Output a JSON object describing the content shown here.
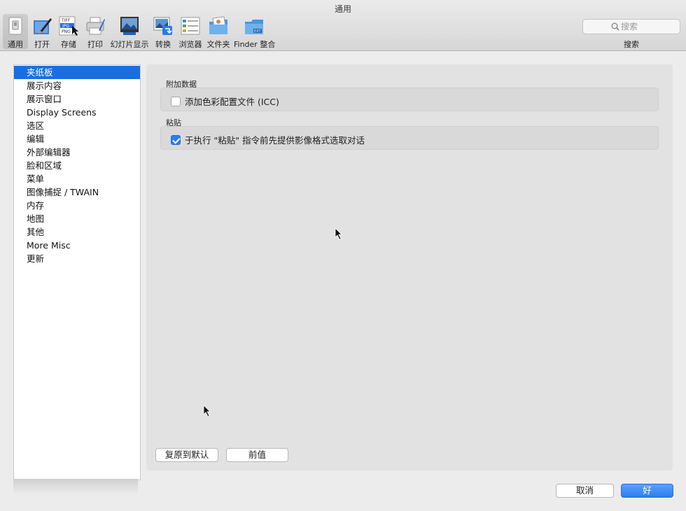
{
  "window": {
    "title": "通用"
  },
  "toolbar": {
    "items": [
      {
        "label": "通用",
        "icon": "general-switch-icon",
        "selected": true
      },
      {
        "label": "打开",
        "icon": "open-brush-icon",
        "selected": false
      },
      {
        "label": "存储",
        "icon": "save-formats-icon",
        "selected": false
      },
      {
        "label": "打印",
        "icon": "printer-icon",
        "selected": false
      },
      {
        "label": "幻灯片显示",
        "icon": "slideshow-icon",
        "selected": false
      },
      {
        "label": "转换",
        "icon": "convert-icon",
        "selected": false
      },
      {
        "label": "浏览器",
        "icon": "browser-icon",
        "selected": false
      },
      {
        "label": "文件夹",
        "icon": "folder-photo-icon",
        "selected": false
      },
      {
        "label": "Finder 整合",
        "icon": "finder-folder-icon",
        "selected": false
      }
    ],
    "search": {
      "placeholder": "搜索",
      "label": "搜索"
    }
  },
  "sidebar": {
    "items": [
      {
        "label": "夹纸板",
        "active": true
      },
      {
        "label": "展示内容",
        "active": false
      },
      {
        "label": "展示窗口",
        "active": false
      },
      {
        "label": "Display Screens",
        "active": false
      },
      {
        "label": "选区",
        "active": false
      },
      {
        "label": "编辑",
        "active": false
      },
      {
        "label": "外部编辑器",
        "active": false
      },
      {
        "label": "脸和区域",
        "active": false
      },
      {
        "label": "菜单",
        "active": false
      },
      {
        "label": "图像捕捉  / TWAIN",
        "active": false
      },
      {
        "label": "内存",
        "active": false
      },
      {
        "label": "地图",
        "active": false
      },
      {
        "label": "其他",
        "active": false
      },
      {
        "label": "More Misc",
        "active": false
      },
      {
        "label": "更新",
        "active": false
      }
    ]
  },
  "main": {
    "groups": [
      {
        "title": "附加数据",
        "option": {
          "label": "添加色彩配置文件 (ICC)",
          "checked": false
        }
      },
      {
        "title": "粘贴",
        "option": {
          "label": "于执行 \"粘贴\" 指令前先提供影像格式选取对话",
          "checked": true
        }
      }
    ],
    "restore_defaults": "复原到默认",
    "previous_value": "前值"
  },
  "footer": {
    "cancel": "取消",
    "ok": "好"
  },
  "colors": {
    "accent": "#1a6fe0",
    "primary_button": "#2a7cf2"
  }
}
